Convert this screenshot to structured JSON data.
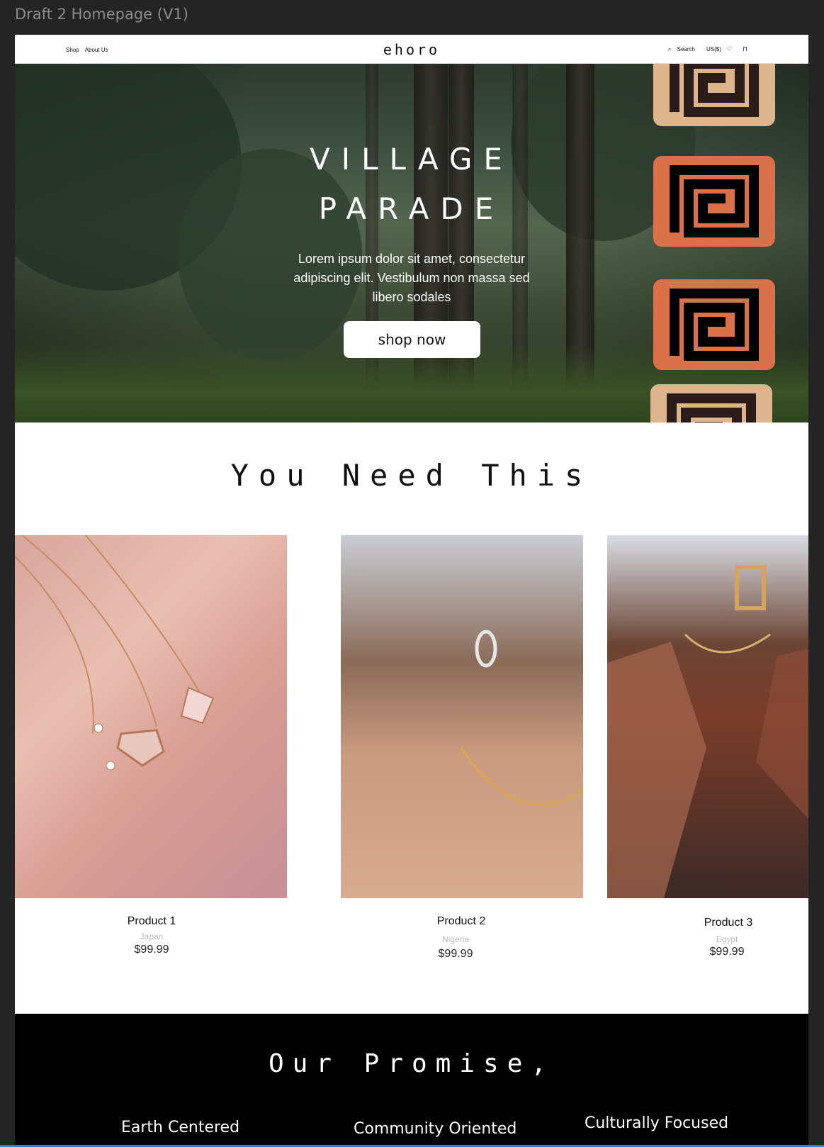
{
  "frame_title": "Draft 2 Homepage (V1)",
  "nav": {
    "left_links": [
      "Shop",
      "About Us"
    ],
    "logo": "ehoro",
    "search_label": "Search",
    "currency": "US($)",
    "icons": [
      "search-icon",
      "heart-icon",
      "bag-icon"
    ]
  },
  "hero": {
    "title_line1": "VILLAGE",
    "title_line2": "PARADE",
    "text": "Lorem ipsum dolor sit amet, consectetur adipiscing elit. Vestibulum non massa sed libero sodales",
    "button_label": "shop now",
    "tile_colors": [
      "#dcb58d",
      "#d9714a",
      "#d9714a",
      "#dcb58d"
    ]
  },
  "products_section": {
    "title": "You Need This",
    "products": [
      {
        "name": "Product 1",
        "origin": "Japan",
        "price": "$99.99"
      },
      {
        "name": "Product 2",
        "origin": "Nigeria",
        "price": "$99.99"
      },
      {
        "name": "Product 3",
        "origin": "Egypt",
        "price": "$99.99"
      }
    ]
  },
  "promise": {
    "title": "Our Promise,",
    "items": [
      "Earth Centered",
      "Community Oriented",
      "Culturally Focused"
    ]
  }
}
